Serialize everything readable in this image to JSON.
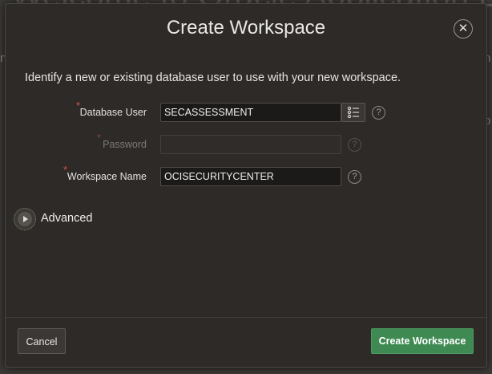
{
  "background": {
    "title": "Welcome to Oracle Application Express!",
    "frag_right_1": "n",
    "frag_right_2": "p"
  },
  "dialog": {
    "title": "Create Workspace",
    "close_icon": "close-icon",
    "intro": "Identify a new or existing database user to use with your new workspace.",
    "fields": {
      "database_user": {
        "label": "Database User",
        "value": "SECASSESSMENT",
        "required": "*"
      },
      "password": {
        "label": "Password",
        "value": "",
        "required": "*"
      },
      "workspace_name": {
        "label": "Workspace Name",
        "value": "OCISECURITYCENTER",
        "required": "*"
      }
    },
    "help_glyph": "?",
    "advanced": {
      "label": "Advanced"
    },
    "buttons": {
      "cancel": "Cancel",
      "create": "Create Workspace"
    }
  },
  "colors": {
    "accent_green": "#3f8a52",
    "required_red": "#d9534f",
    "dialog_bg": "#2d2a27"
  }
}
